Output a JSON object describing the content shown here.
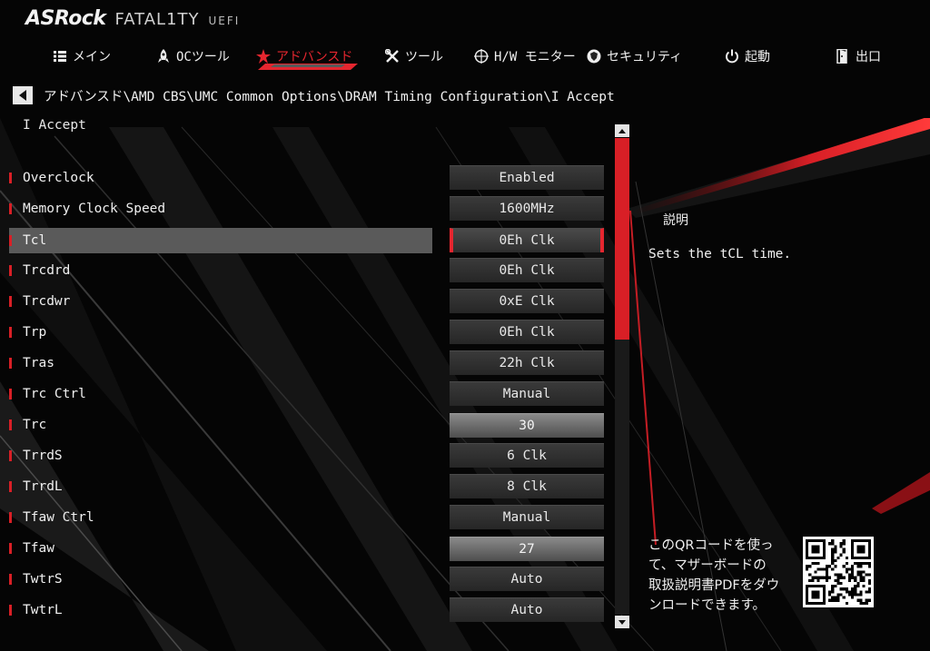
{
  "brand": {
    "name": "ASRock",
    "line": "FATAL1TY",
    "suffix": "UEFI"
  },
  "colors": {
    "accent": "#e5262f",
    "background": "#050505",
    "text": "#e6e6e6"
  },
  "nav": [
    {
      "label": "メイン",
      "icon": "list-icon",
      "active": false
    },
    {
      "label": "OCツール",
      "icon": "rocket-icon",
      "active": false
    },
    {
      "label": "アドバンスド",
      "icon": "star-icon",
      "active": true
    },
    {
      "label": "ツール",
      "icon": "tools-icon",
      "active": false
    },
    {
      "label": "H/W モニター",
      "icon": "crosshair-icon",
      "active": false
    },
    {
      "label": "セキュリティ",
      "icon": "shield-icon",
      "active": false
    },
    {
      "label": "起動",
      "icon": "power-icon",
      "active": false
    },
    {
      "label": "出口",
      "icon": "exit-icon",
      "active": false
    }
  ],
  "breadcrumb": "アドバンスド\\AMD CBS\\UMC Common Options\\DRAM Timing Configuration\\I Accept",
  "page_title": "I Accept",
  "settings": [
    {
      "label": "Overclock",
      "value": "Enabled",
      "type": "option",
      "selected": false
    },
    {
      "label": "Memory Clock Speed",
      "value": "1600MHz",
      "type": "option",
      "selected": false
    },
    {
      "label": "Tcl",
      "value": "0Eh Clk",
      "type": "option",
      "selected": true
    },
    {
      "label": "Trcdrd",
      "value": "0Eh Clk",
      "type": "option",
      "selected": false
    },
    {
      "label": "Trcdwr",
      "value": "0xE Clk",
      "type": "option",
      "selected": false
    },
    {
      "label": "Trp",
      "value": "0Eh Clk",
      "type": "option",
      "selected": false
    },
    {
      "label": "Tras",
      "value": "22h Clk",
      "type": "option",
      "selected": false
    },
    {
      "label": "Trc Ctrl",
      "value": "Manual",
      "type": "option",
      "selected": false
    },
    {
      "label": "Trc",
      "value": "30",
      "type": "input",
      "selected": false
    },
    {
      "label": "TrrdS",
      "value": "6 Clk",
      "type": "option",
      "selected": false
    },
    {
      "label": "TrrdL",
      "value": "8 Clk",
      "type": "option",
      "selected": false
    },
    {
      "label": "Tfaw Ctrl",
      "value": "Manual",
      "type": "option",
      "selected": false
    },
    {
      "label": "Tfaw",
      "value": "27",
      "type": "input",
      "selected": false
    },
    {
      "label": "TwtrS",
      "value": "Auto",
      "type": "option",
      "selected": false
    },
    {
      "label": "TwtrL",
      "value": "Auto",
      "type": "option",
      "selected": false
    }
  ],
  "help": {
    "title": "説明",
    "text": "Sets the tCL time."
  },
  "qr_help": {
    "lines": [
      "このQRコードを使っ",
      "て、マザーボードの",
      "取扱説明書PDFをダウ",
      "ンロードできます。"
    ]
  }
}
